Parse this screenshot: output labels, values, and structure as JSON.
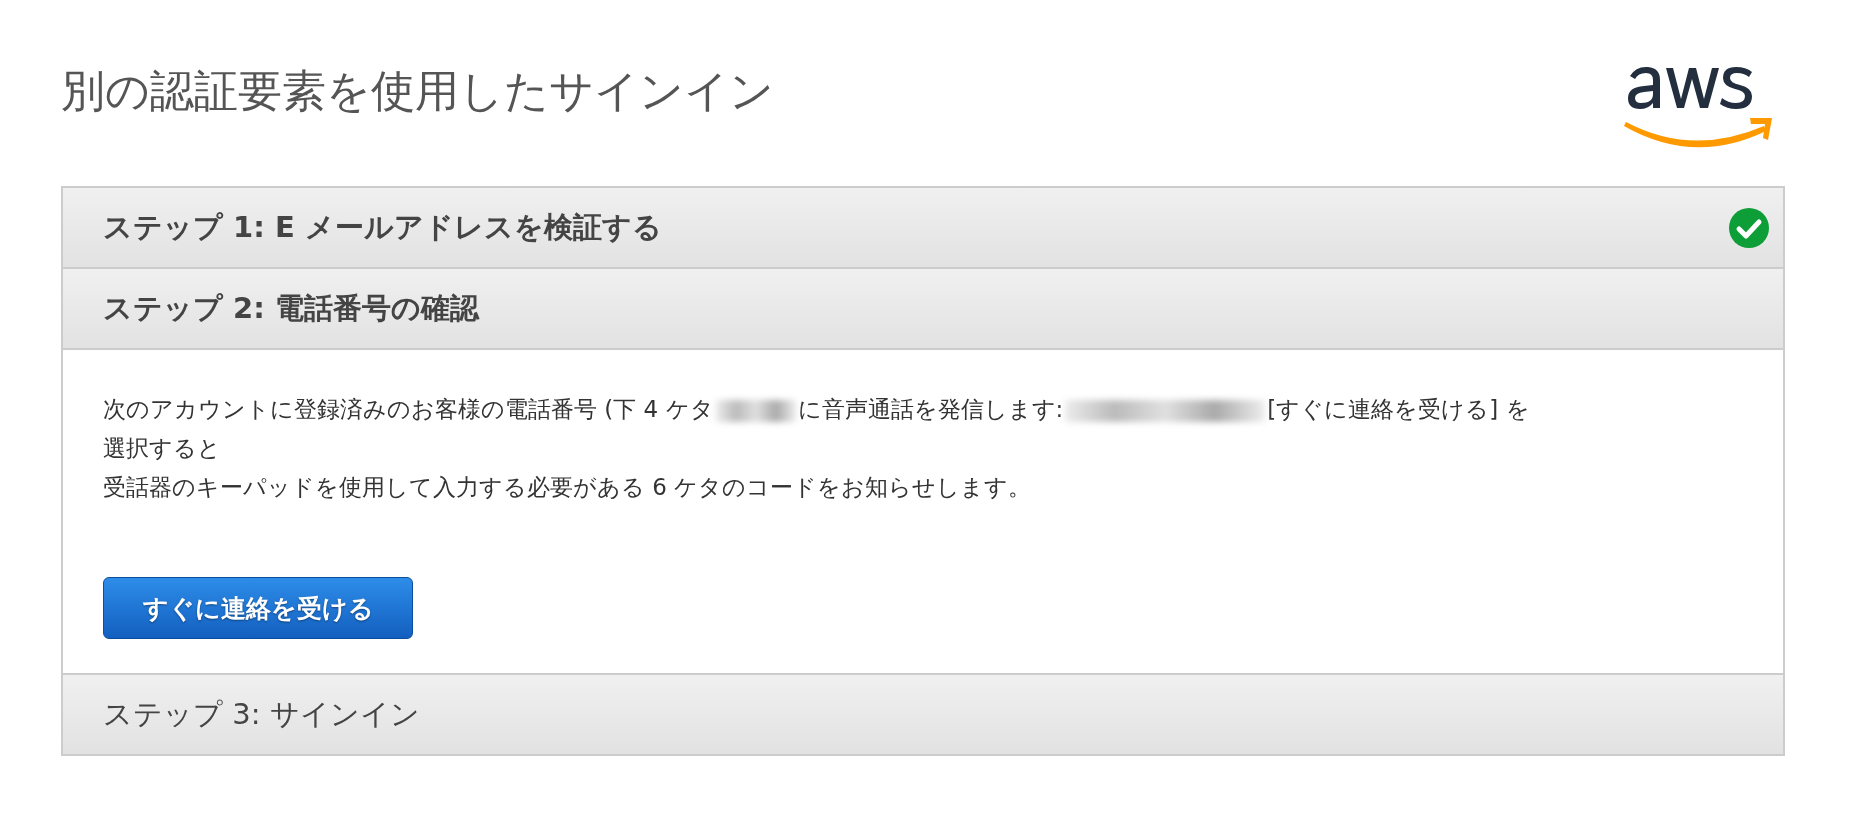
{
  "page_title": "別の認証要素を使用したサインイン",
  "steps": [
    {
      "title": "ステップ 1: E メールアドレスを検証する",
      "completed": true,
      "expanded": false
    },
    {
      "title": "ステップ 2: 電話番号の確認",
      "completed": false,
      "expanded": true,
      "body": {
        "lines": [
          {
            "segments": [
              {
                "kind": "text",
                "text": "次のアカウントに登録済みのお客様の電話番号 (下 4 ケタ"
              },
              {
                "kind": "redacted"
              },
              {
                "kind": "text",
                "text": "に音声通話を発信します:"
              },
              {
                "kind": "redacted"
              },
              {
                "kind": "text",
                "text": "[すぐに連絡を受ける] を"
              }
            ]
          },
          {
            "segments": [
              {
                "kind": "text",
                "text": "選択すると"
              }
            ]
          },
          {
            "segments": [
              {
                "kind": "text",
                "text": "受話器のキーパッドを使用して入力する必要がある 6 ケタのコードをお知らせします。"
              }
            ]
          }
        ],
        "button": "すぐに連絡を受ける"
      }
    },
    {
      "title": "ステップ 3: サインイン",
      "completed": false,
      "expanded": false
    }
  ]
}
